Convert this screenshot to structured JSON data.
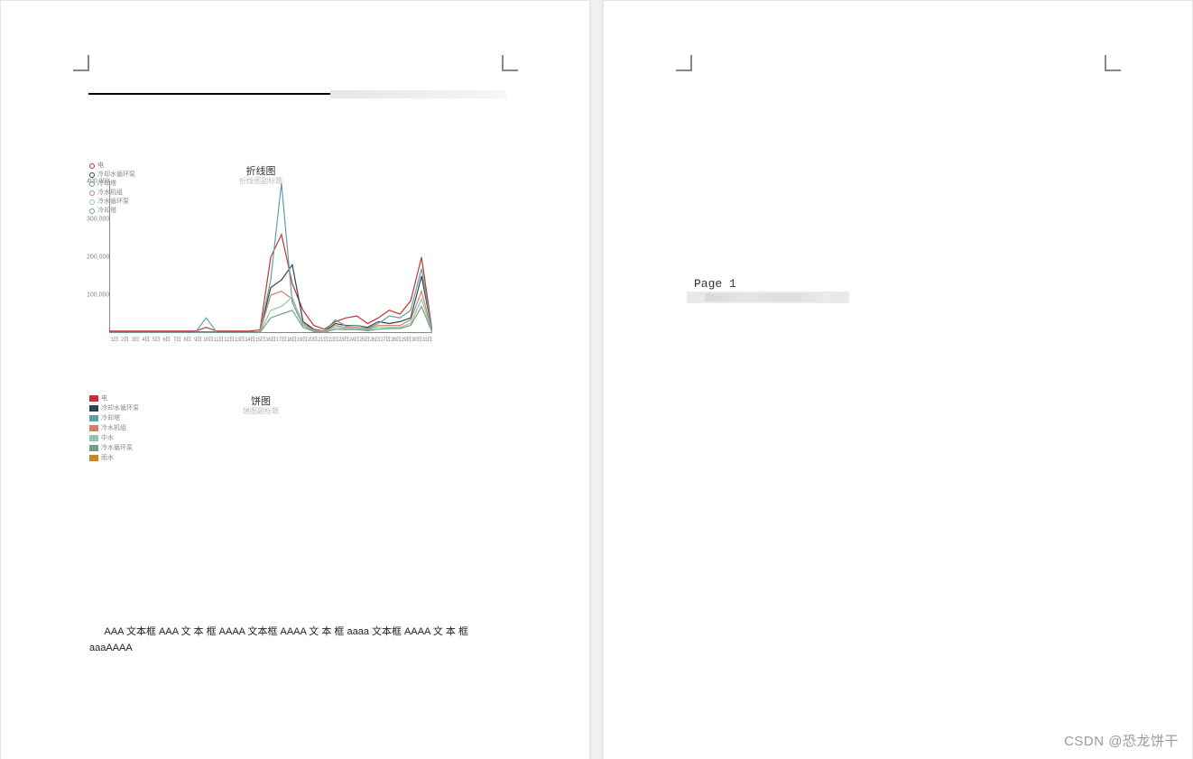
{
  "watermark": "CSDN @恐龙饼干",
  "page_right": {
    "page_label": "Page 1"
  },
  "body_text": "AAA 文本框 AAA 文 本 框 AAAA 文本框 AAAA 文 本 框 aaaa 文本框 AAAA 文 本 框 aaaAAAA",
  "chart_data": [
    {
      "type": "line",
      "title": "折线图",
      "subtitle": "折线图副标题",
      "xlabel": "",
      "ylabel": "",
      "ylim": [
        0,
        400000
      ],
      "yticks": [
        0,
        100000,
        200000,
        300000,
        400000
      ],
      "ytick_labels": [
        "",
        "100,000",
        "200,000",
        "300,000",
        "400,000"
      ],
      "categories": [
        "1日",
        "2日",
        "3日",
        "4日",
        "5日",
        "6日",
        "7日",
        "8日",
        "9日",
        "10日",
        "11日",
        "12日",
        "13日",
        "14日",
        "15日",
        "16日",
        "17日",
        "18日",
        "19日",
        "20日",
        "21日",
        "22日",
        "23日",
        "24日",
        "25日",
        "26日",
        "27日",
        "28日",
        "29日",
        "30日",
        "31日"
      ],
      "series": [
        {
          "name": "电",
          "color": "#c23531",
          "values": [
            5000,
            5000,
            5000,
            5000,
            5000,
            5000,
            5000,
            5000,
            5000,
            15000,
            5000,
            5000,
            5000,
            5000,
            8000,
            200000,
            260000,
            130000,
            60000,
            20000,
            10000,
            30000,
            40000,
            45000,
            25000,
            40000,
            60000,
            50000,
            85000,
            200000,
            5000
          ]
        },
        {
          "name": "冷却水循环泵",
          "color": "#2f4554",
          "values": [
            3000,
            3000,
            3000,
            3000,
            3000,
            3000,
            3000,
            3000,
            3000,
            3000,
            3000,
            3000,
            3000,
            3000,
            3000,
            120000,
            140000,
            180000,
            30000,
            10000,
            5000,
            25000,
            20000,
            20000,
            15000,
            30000,
            25000,
            30000,
            40000,
            150000,
            3000
          ]
        },
        {
          "name": "冷却塔",
          "color": "#61a0a8",
          "values": [
            2000,
            2000,
            2000,
            2000,
            2000,
            2000,
            2000,
            2000,
            2000,
            40000,
            2000,
            2000,
            2000,
            2000,
            4000,
            140000,
            395000,
            80000,
            20000,
            8000,
            5000,
            35000,
            18000,
            20000,
            12000,
            25000,
            45000,
            40000,
            60000,
            170000,
            2000
          ]
        },
        {
          "name": "冷水机组",
          "color": "#d48265",
          "values": [
            2000,
            2000,
            2000,
            2000,
            2000,
            2000,
            2000,
            2000,
            2000,
            2000,
            2000,
            2000,
            2000,
            2000,
            2000,
            100000,
            110000,
            90000,
            25000,
            8000,
            4000,
            20000,
            15000,
            15000,
            10000,
            20000,
            20000,
            20000,
            35000,
            110000,
            2000
          ]
        },
        {
          "name": "冷水循环泵",
          "color": "#91c7ae",
          "values": [
            1000,
            1000,
            1000,
            1000,
            1000,
            1000,
            1000,
            1000,
            1000,
            1000,
            1000,
            1000,
            1000,
            1000,
            1000,
            60000,
            70000,
            95000,
            20000,
            5000,
            3000,
            15000,
            12000,
            12000,
            8000,
            15000,
            15000,
            15000,
            25000,
            90000,
            1000
          ]
        },
        {
          "name": "冷却塔",
          "color": "#749f83",
          "values": [
            1000,
            1000,
            1000,
            1000,
            1000,
            1000,
            1000,
            1000,
            1000,
            1000,
            1000,
            1000,
            1000,
            1000,
            1000,
            40000,
            50000,
            60000,
            15000,
            4000,
            2000,
            10000,
            9000,
            9000,
            6000,
            10000,
            12000,
            12000,
            20000,
            70000,
            1000
          ]
        }
      ]
    },
    {
      "type": "pie",
      "title": "饼图",
      "subtitle": "饼图副标题",
      "series": [
        {
          "name": "电",
          "color": "#c23531"
        },
        {
          "name": "冷却水循环泵",
          "color": "#2f4554"
        },
        {
          "name": "冷却塔",
          "color": "#61a0a8"
        },
        {
          "name": "冷水机组",
          "color": "#d48265"
        },
        {
          "name": "中水",
          "color": "#91c7ae"
        },
        {
          "name": "冷水循环泵",
          "color": "#749f83"
        },
        {
          "name": "雨水",
          "color": "#ca8622"
        }
      ]
    }
  ]
}
